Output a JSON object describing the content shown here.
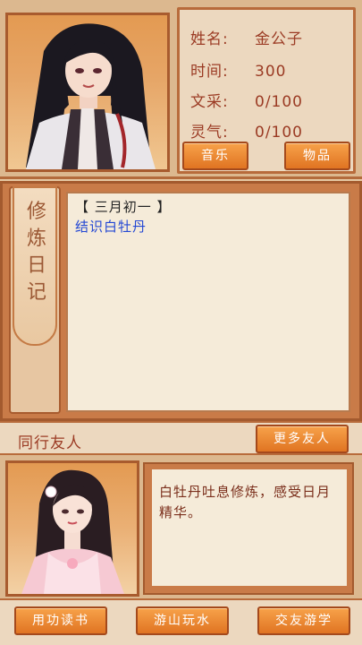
{
  "character": {
    "name_label": "姓名:",
    "name_value": "金公子",
    "time_label": "时间:",
    "time_value": "300",
    "literary_label": "文采:",
    "literary_value": "0/100",
    "spirit_label": "灵气:",
    "spirit_value": "0/100"
  },
  "buttons": {
    "music": "音乐",
    "items": "物品",
    "more_friends": "更多友人",
    "study": "用功读书",
    "travel": "游山玩水",
    "socialize": "交友游学"
  },
  "diary": {
    "title_chars": [
      "修",
      "炼",
      "日",
      "记"
    ],
    "date": "【 三月初一 】",
    "entry": "结识白牡丹"
  },
  "friends": {
    "title": "同行友人",
    "message": "白牡丹吐息修炼，感受日月精华。"
  }
}
